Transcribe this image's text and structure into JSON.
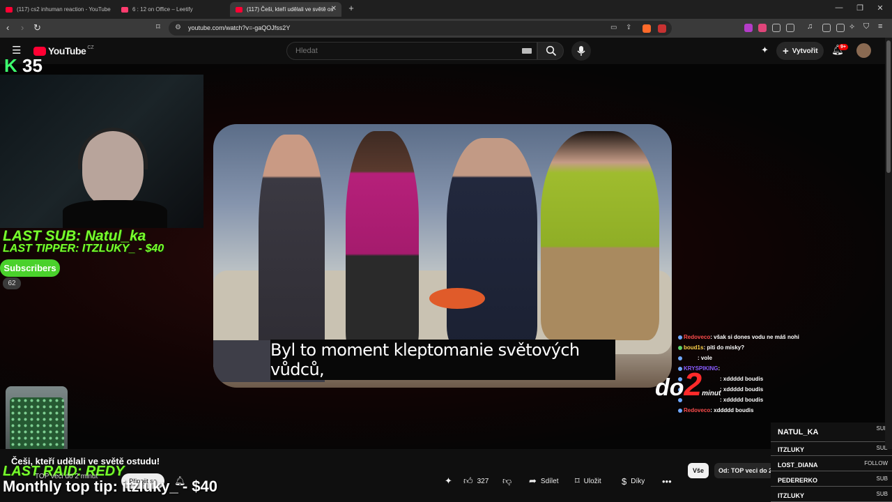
{
  "browser": {
    "tabs": [
      {
        "title": "(117) cs2 inhuman reaction - YouTube",
        "favicon_color": "#ff0033"
      },
      {
        "title": "6 : 12 on Office – Leetify",
        "favicon_color": "#ff3c6e"
      },
      {
        "title": "(117) Češi, kteří udělali ve světě os",
        "favicon_color": "#ff0033"
      }
    ],
    "new_tab": "+",
    "url": "youtube.com/watch?v=-gaQOJfss2Y",
    "window_controls": [
      "—",
      "❐",
      "✕"
    ]
  },
  "youtube": {
    "logo_text": "YouTube",
    "region": "CZ",
    "search_placeholder": "Hledat",
    "create_label": "Vytvořit",
    "notification_count": "9+"
  },
  "overlay": {
    "k_logo": "K",
    "k_number": "35",
    "last_sub": "LAST SUB: Natul_ka",
    "last_tipper": "LAST TIPPER: ITZLUKY_ - $40",
    "subscribers_label": "Subscribers",
    "subscribers_count": "62",
    "last_raid": "LAST RAID: REDY",
    "monthly_top_tip": "Monthly top tip: itzluky_ - $40",
    "do2_text": "do",
    "do2_num": "2",
    "do2_small": "minut"
  },
  "video": {
    "subtitle": "Byl to moment kleptomanie světových vůdců,"
  },
  "below_video": {
    "title": "Češi, kteří udělali ve světě ostudu!",
    "channel": "TOP veci do 2 minut",
    "join_label": "Připojit se",
    "likes": "327",
    "share_label": "Sdílet",
    "save_label": "Uložit",
    "thanks_label": "Díky",
    "chip_all": "Vše",
    "chip_from": "Od: TOP veci do 2 minut"
  },
  "chat": [
    {
      "user": "Redoveco",
      "msg": ": však si dones vodu ne máš nohi"
    },
    {
      "user": "boud1s",
      "msg": ": piti do misky?"
    },
    {
      "user": "",
      "msg": ": vole"
    },
    {
      "user": "KRYSPIKING",
      "msg": ":"
    },
    {
      "user": "",
      "msg": ": xddddd boudis"
    },
    {
      "user": "",
      "msg": ": xddddd boudis"
    },
    {
      "user": "",
      "msg": ": xddddd boudis"
    },
    {
      "user": "Redoveco",
      "msg": ": xddddd boudis"
    }
  ],
  "followers": [
    {
      "name": "NATUL_KA",
      "type": "SUB"
    },
    {
      "name": "ITZLUKY",
      "type": "SUB"
    },
    {
      "name": "LOST_DIANA",
      "type": "FOLLOW"
    },
    {
      "name": "PEDERERKO",
      "type": "SUB"
    },
    {
      "name": "ITZLUKY",
      "type": "SUB"
    }
  ]
}
